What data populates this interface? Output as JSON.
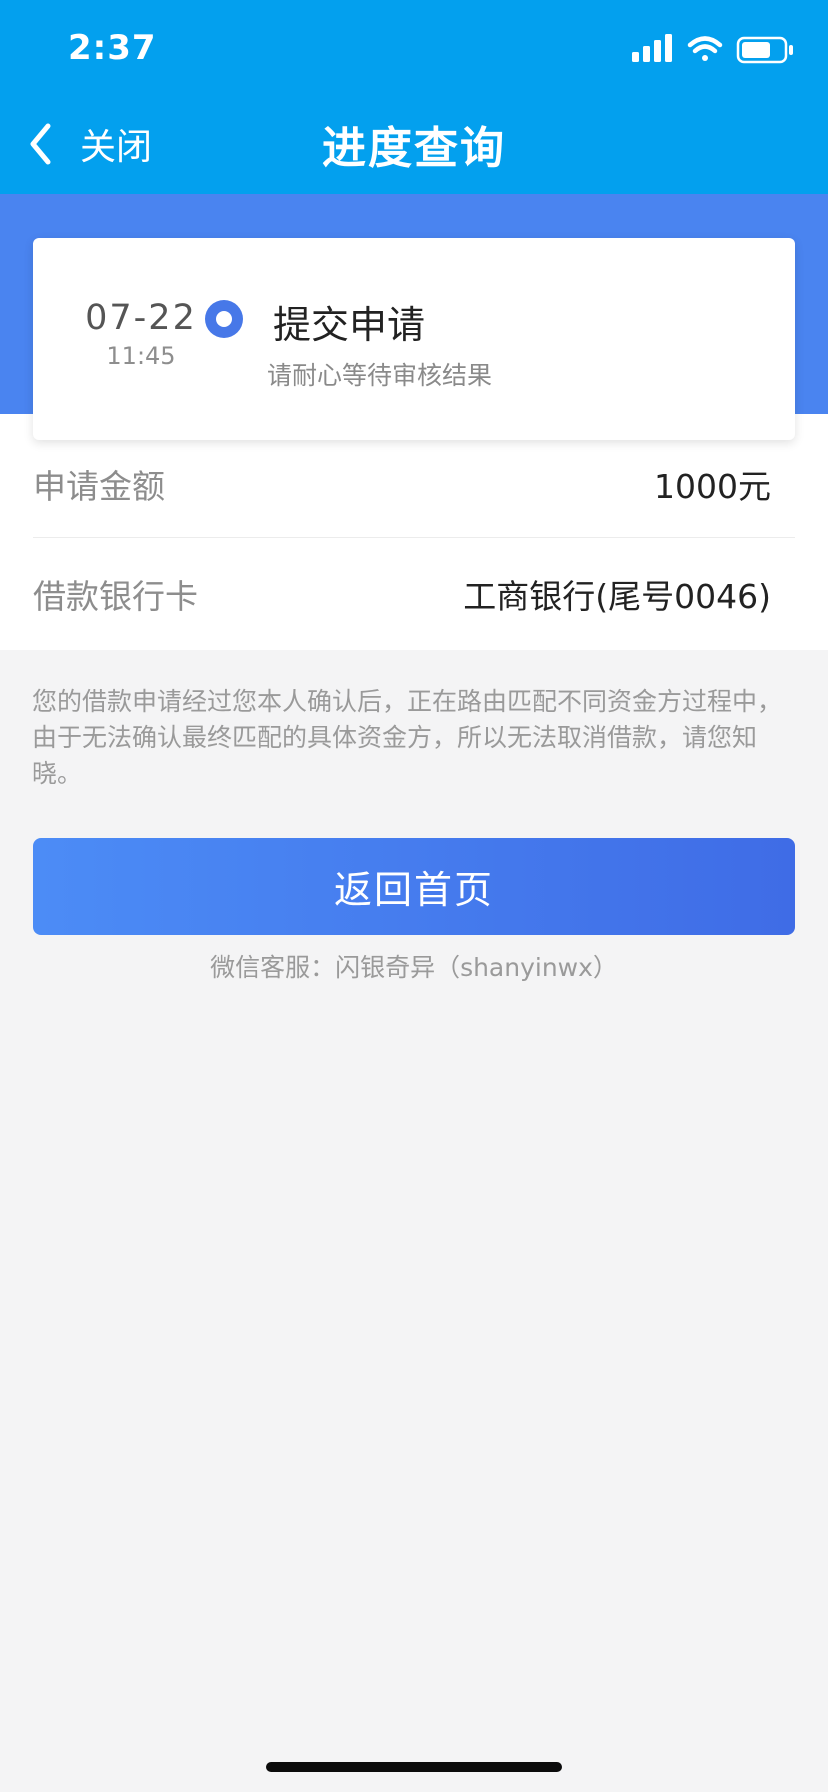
{
  "status_bar": {
    "time": "2:37"
  },
  "nav": {
    "back_label": "关闭",
    "title": "进度查询"
  },
  "progress": {
    "date": "07-22",
    "time": "11:45",
    "step": "提交申请",
    "note": "请耐心等待审核结果"
  },
  "details": [
    {
      "label": "申请金额",
      "value": "1000元"
    },
    {
      "label": "借款银行卡",
      "value": "工商银行(尾号0046)"
    }
  ],
  "notice": "您的借款申请经过您本人确认后，正在路由匹配不同资金方过程中，由于无法确认最终匹配的具体资金方，所以无法取消借款，请您知晓。",
  "home_button": {
    "label": "返回首页"
  },
  "service_text": "微信客服：闪银奇异（shanyinwx）",
  "colors": {
    "header": "#03a0ee",
    "band": "#4a84f0",
    "button_start": "#4c8cf6",
    "button_end": "#3f6ce6",
    "step_dot": "#4778e8"
  }
}
